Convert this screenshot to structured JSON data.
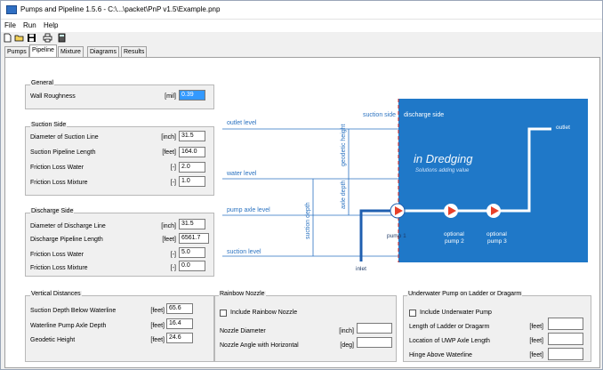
{
  "window": {
    "title": "Pumps and Pipeline 1.5.6 - C:\\...\\packet\\PnP v1.5\\Example.pnp"
  },
  "menu": [
    "File",
    "Run",
    "Help"
  ],
  "toolbar": {
    "new": "new-file-icon",
    "open": "open-folder-icon",
    "save": "save-icon",
    "print": "printer-icon",
    "calc": "calculator-icon"
  },
  "tabs": [
    {
      "label": "Pumps"
    },
    {
      "label": "Pipeline",
      "active": true
    },
    {
      "label": "Mixture"
    },
    {
      "label": "Diagrams"
    },
    {
      "label": "Results"
    }
  ],
  "general": {
    "title": "General",
    "wall_roughness": {
      "label": "Wall Roughness",
      "unit": "[mil]",
      "value": "0.39"
    }
  },
  "suction": {
    "title": "Suction Side",
    "diameter": {
      "label": "Diameter of Suction Line",
      "unit": "[inch]",
      "value": "31.5"
    },
    "length": {
      "label": "Suction Pipeline Length",
      "unit": "[feet]",
      "value": "164.0"
    },
    "friction_water": {
      "label": "Friction Loss Water",
      "unit": "[-]",
      "value": "2.0"
    },
    "friction_mixture": {
      "label": "Friction Loss Mixture",
      "unit": "[-]",
      "value": "1.0"
    }
  },
  "discharge": {
    "title": "Discharge Side",
    "diameter": {
      "label": "Diameter of Discharge Line",
      "unit": "[inch]",
      "value": "31.5"
    },
    "length": {
      "label": "Discharge Pipeline Length",
      "unit": "[feet]",
      "value": "6561.7"
    },
    "friction_water": {
      "label": "Friction Loss Water",
      "unit": "[-]",
      "value": "5.0"
    },
    "friction_mixture": {
      "label": "Friction Loss Mixture",
      "unit": "[-]",
      "value": "0.0"
    }
  },
  "vertical": {
    "title": "Vertical Distances",
    "suction_depth": {
      "label": "Suction Depth Below Waterline",
      "unit": "[feet]",
      "value": "65.6"
    },
    "axle_depth": {
      "label": "Waterline Pump Axle Depth",
      "unit": "[feet]",
      "value": "16.4"
    },
    "geodetic": {
      "label": "Geodetic Height",
      "unit": "[feet]",
      "value": "24.6"
    }
  },
  "rainbow": {
    "title": "Rainbow Nozzle",
    "include": "Include Rainbow Nozzle",
    "diameter": {
      "label": "Nozzle Diameter",
      "unit": "[inch]",
      "value": ""
    },
    "angle": {
      "label": "Nozzle Angle with Horizontal",
      "unit": "[deg]",
      "value": ""
    }
  },
  "underwater": {
    "title": "Underwater Pump on Ladder or Dragarm",
    "include": "Include Underwater Pump",
    "ladder_length": {
      "label": "Length of Ladder or Dragarm",
      "unit": "[feet]",
      "value": ""
    },
    "uwp_location": {
      "label": "Location of UWP Axle Length",
      "unit": "[feet]",
      "value": ""
    },
    "hinge": {
      "label": "Hinge Above Waterline",
      "unit": "[feet]",
      "value": ""
    }
  },
  "diagram": {
    "suction_side": "suction side",
    "discharge_side": "discharge side",
    "outlet_level": "outlet level",
    "water_level": "water level",
    "pump_axle_level": "pump axle level",
    "suction_level": "suction level",
    "geodetic_height": "geodetic height",
    "axle_depth": "axle depth",
    "suction_depth": "suction depth",
    "outlet": "outlet",
    "inlet": "inlet",
    "pump1": "pump 1",
    "pump2_a": "optional",
    "pump2_b": "pump 2",
    "pump3_a": "optional",
    "pump3_b": "pump 3",
    "logo_text": "in Dredging",
    "logo_tagline": "Solutions adding value",
    "colors": {
      "blue": "#1f78c8",
      "red": "#e8402a",
      "line": "#2a72c0"
    }
  }
}
